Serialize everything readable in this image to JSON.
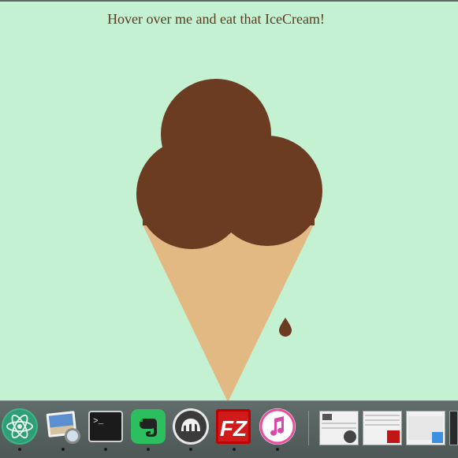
{
  "page": {
    "heading": "Hover over me and eat that IceCream!",
    "background": "#c3f1d1",
    "heading_color": "#5a3a24"
  },
  "icecream": {
    "scoop_color": "#6b3b22",
    "cone_color": "#e2b883",
    "drip_color": "#6b3b22"
  },
  "dock": {
    "apps": [
      {
        "name": "Atom",
        "icon": "atom-icon",
        "running": true
      },
      {
        "name": "Preview",
        "icon": "preview-icon",
        "running": true
      },
      {
        "name": "Terminal",
        "icon": "terminal-icon",
        "running": true
      },
      {
        "name": "Evernote",
        "icon": "evernote-icon",
        "running": true
      },
      {
        "name": "MAMP",
        "icon": "mamp-icon",
        "running": true
      },
      {
        "name": "FileZilla",
        "icon": "filezilla-icon",
        "running": true
      },
      {
        "name": "iTunes",
        "icon": "itunes-icon",
        "running": true
      }
    ],
    "terminal_prompt": ">_",
    "filezilla_glyph": "FZ",
    "minimized_windows": [
      "MAMP window",
      "FileZilla window",
      "Finder window",
      "Window"
    ]
  }
}
